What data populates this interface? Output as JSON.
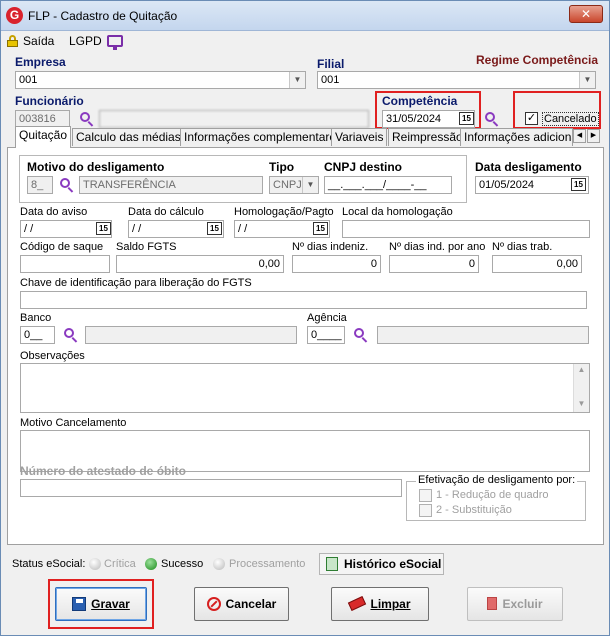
{
  "window": {
    "title": "FLP - Cadastro de Quitação",
    "close_glyph": "✕",
    "app_icon": "G"
  },
  "menu": {
    "exit": "Saída",
    "lgpd": "LGPD"
  },
  "header": {
    "empresa_label": "Empresa",
    "empresa_value": "001",
    "filial_label": "Filial",
    "filial_value": "001",
    "regime_label": "Regime Competência",
    "funcionario_label": "Funcionário",
    "funcionario_code": "003816",
    "competencia_label": "Competência",
    "competencia_value": "31/05/2024",
    "cancelado_label": "Cancelado",
    "cancelado_checked": "✓"
  },
  "tabs": [
    {
      "label": "Quitação"
    },
    {
      "label": "Calculo das médias"
    },
    {
      "label": "Informações complementares"
    },
    {
      "label": "Variaveis"
    },
    {
      "label": "Reimpressão"
    },
    {
      "label": "Informações adicionais"
    }
  ],
  "quitacao": {
    "motivo_label": "Motivo do desligamento",
    "motivo_code": "8_",
    "motivo_desc": "TRANSFERÊNCIA",
    "tipo_label": "Tipo",
    "tipo_value": "CNPJ",
    "cnpj_label": "CNPJ destino",
    "cnpj_value": "__.___.___/____-__",
    "data_desl_label": "Data desligamento",
    "data_desl_value": "01/05/2024",
    "data_aviso_label": "Data do aviso",
    "data_aviso_value": "/ /",
    "data_calculo_label": "Data do cálculo",
    "data_calculo_value": "/ /",
    "homologacao_label": "Homologação/Pagto",
    "homologacao_value": "/ /",
    "local_homologacao_label": "Local da homologação",
    "codigo_saque_label": "Código de saque",
    "saldo_fgts_label": "Saldo FGTS",
    "saldo_fgts_value": "0,00",
    "dias_indeniz_label": "Nº dias indeniz.",
    "dias_indeniz_value": "0",
    "dias_ind_ano_label": "Nº dias ind. por ano",
    "dias_ind_ano_value": "0",
    "dias_trab_label": "Nº dias trab.",
    "dias_trab_value": "0,00",
    "chave_fgts_label": "Chave de identificação para liberação do FGTS",
    "banco_label": "Banco",
    "banco_value": "0__",
    "agencia_label": "Agência",
    "agencia_value": "0____",
    "observacoes_label": "Observações",
    "motivo_cancelamento_label": "Motivo Cancelamento",
    "atestado_label": "Número do atestado de óbito",
    "efetivacao_label": "Efetivação de desligamento por:",
    "efetivacao_opt1": "1 - Redução de quadro",
    "efetivacao_opt2": "2 - Substituição"
  },
  "status": {
    "label": "Status eSocial:",
    "critica": "Crítica",
    "sucesso": "Sucesso",
    "processamento": "Processamento",
    "historico": "Histórico eSocial",
    "colors": {
      "critica": "#b8b8b8",
      "sucesso": "#1a8a1a",
      "processamento": "#b8b8b8"
    }
  },
  "buttons": {
    "gravar": "Gravar",
    "cancelar": "Cancelar",
    "limpar": "Limpar",
    "excluir": "Excluir"
  }
}
